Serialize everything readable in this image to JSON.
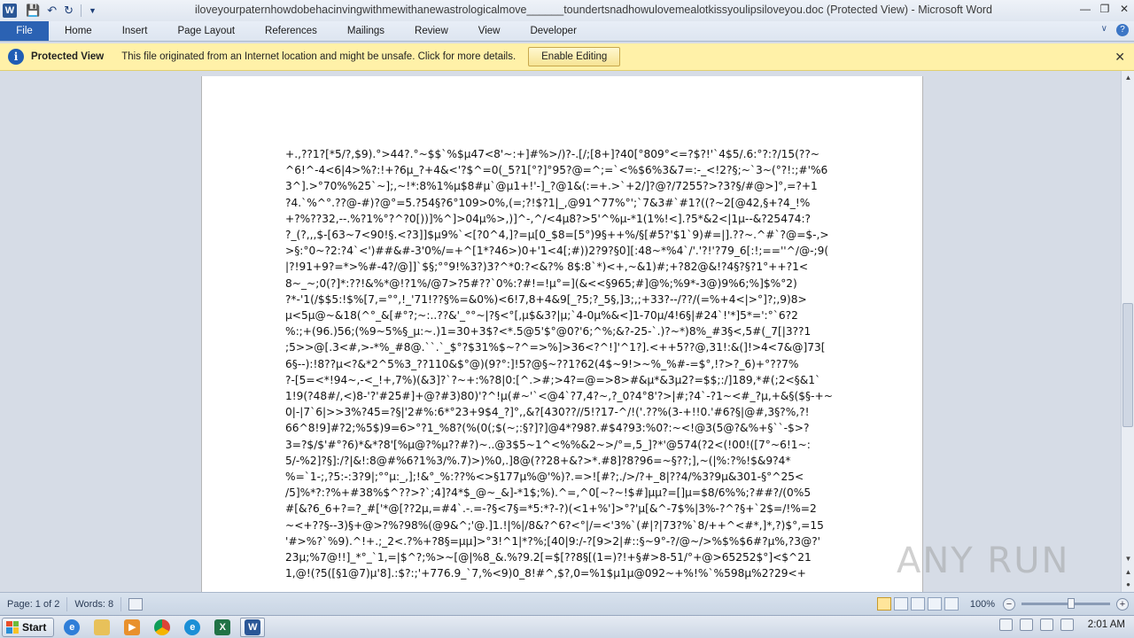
{
  "app": {
    "window_title": "iloveyourpaternhowdobehacinvingwithmewithanewastrologicalmove______toundertsnadhowulovemealotkissyoulipsiloveyou.doc (Protected View) - Microsoft Word",
    "icon_letter": "W"
  },
  "ribbon": {
    "tabs": [
      "File",
      "Home",
      "Insert",
      "Page Layout",
      "References",
      "Mailings",
      "Review",
      "View",
      "Developer"
    ]
  },
  "protected_view": {
    "title": "Protected View",
    "message": "This file originated from an Internet location and might be unsafe. Click for more details.",
    "button": "Enable Editing"
  },
  "document": {
    "lines": [
      "+.,??1?[*5/?,$9).°>44?.°~$$`%$µ47<8'~:+]#%>/)?-.[/;[8+]?40[°809°<=?$?!'`4$5/.6:°?:?/15(??~",
      "^6!^-4<6|4>%?:!+?6µ_?+4&<'?$^=0(_5?1[°?]°95?@=^;=`<%$6%3&7=:-_<!2?§;~`3~(°?!:;#'%6",
      "3^].>°70%%25`~];,~!*:8%1%µ$8#µ`@µ1+!'-]_?@1&(:=+.>`+2/]?@?/7255?>?3?§/#@>]°,=?+1",
      "?4.`%^°.??@-#)?@°=5.?54§?6°109>0%,(=;?!$?1|_,@91^77%°';`7&3#`#1?((?~2[@42,§+?4_!%",
      "+?%??32,--.%?1%°?^?0[))]%^]>04µ%>,)]^-,^/<4µ8?>5'^%µ-*1(1%!<].?5*&2<|1µ--&?25474:?",
      "?_(?,,,$-[63~7<90!§.<?3]]$µ9%`<[?0^4,]?=µ[0_$8=[5°)9§++%/§[#5?'$1`9)#=|].??~.^#`?@=$-,>",
      ">§:°0~?2:?4`<')##&#-3'0%/=+^[1*?46>)0+'1<4[;#))2?9?§0][:48~*%4`/'.'?!'?79_6[:!;==''^/@-;9(",
      "|?!91+9?=*>%#-4?/@]]`$§;°°9!%3?)3?^*0:?<&?% 8$:8`*)<+,~&1)#;+?82@&!?4§?§?1°++?1<",
      "8~_~;0(?]*:??!&%*@!?1%/@7>?5#??`0%:?#!=!µ°=](&<<§965;#]@%;%9*-3@)9%6;%]$%°2)",
      "?*-'1(/$$5:!$%[7,=°°,!_'71!??§%=&0%)<6!7,8+4&9[_?5;?_5§,]3;,;+33?--/??/(=%+4<|>°]?;,9)8>",
      "µ<5µ@~&18(^°_&[#°?;~:..??&'_°°~|?§<°[,µ$&3?|µ;`4-0µ%&<]1-70µ/4!6§|#24`!'*]5*=':°`6?2",
      "%:;+(96.)56;(%9~5%§_µ:~.)1=30+3$?<*.5@5'$°@0?'6;^%;&?-25-`.)?~*)8%_#3§<,5#(_7[|3??1",
      ";5>>@[.3<#,>-*%_#8@.``.`_$°?$31%$~?^=>%]>36<?^!]'^1?].<++5??@,31!:&(]!>4<7&@]73[",
      "6§--):!8??µ<?&*2^5%3_??110&$°@)(9?°:]!5?@§~??1?62(4$~9!>~%_%#-=$°,!?>?_6)+°??7%",
      "?-[5=<*!94~,-<_!+,7%)(&3]?`?~+:%?8|0:[^.>#;>4?=@=>8>#&µ*&3µ2?=$$;:/]189,*#(;2<§&1`",
      "1!9(?48#/,<)8-'?'#25#]+@?#3)80)'?^!µ(#~'`<@4`?7,4?~,?_0?4°8'?>|#;?4`-?1~<#_?µ,+&§($§-+~",
      "0|-|7`6|>>3%?45=?§|'2#%:6*°23+9$4_?]°,,&?[430??//5!?17-^/!('.??%(3-+!!0.'#6?§|@#,3§?%,?!",
      "66^8!9]#?2;%5$)9=6>°?1_%8?(%(0(;$(~;:§?]?]@4*?98?.#$4?93:%0?:~<!@3(5@?&%+§``-$>?",
      "3=?$/$'#°?6)*&*?8'[%µ@?%µ??#?)~..@3$5~1^<%%&2~>/°=,5_]?*'@574(?2<(!00!([7°~6!1~:",
      "5/-%2]?§]:/?|&!:8@#%6?1%3/%.7)>)%0,.]8@(??28+&?>*.#8]?8?96=~§??;],~(|%:?%!$&9?4*",
      "%=`1-;,?5:-:3?9|;°°µ:_,];!&°_%:??%<>§177µ%@'%)?.=>![#?;./>/?+_8|??4/%3?9µ&301-§°^25<",
      "/5]%*?:?%+#38%$^??>?`;4]?4*$_@~_&]-*1$;%).^=,^0[~?~!$#]µµ?=[]µ=$8/6%%;?##?/(0%5",
      "#[&?6_6+?=?_#['*@[??2µ,=#4`.-.=-?§<7§=*5:*?-?)(<1+%']>°?'µ[&^-7$%|3%-?^?§+`2$=/!%=2",
      "~<+??§--3)§+@>?%?98%(@9&^;'@.]1.!|%|/8&?^6?<°|/=<'3%`(#|?|73?%`8/++^<#*,]*,?)$°,=15",
      "'#>%?`%9).^!+.;_2<.?%+?8§=µµ]>°3!^1|*?%;[40|9:/-?[9>2|#::§~9°-?/@~/>%$%$6#?µ%,?3@?'",
      "23µ;%7@!!]_*°_`1,=|$^?;%>~[@|%8_&.%?9.2[=$[??8§[(1=)?!+§#>8-51/°+@>65252$°]<$^21",
      "1,@!(?5([§1@7)µ'8].:$?:;'+776.9_`7,%<9)0_8!#^,$?,0=%1$µ1µ@092~+%!%`%598µ%2?29<+"
    ]
  },
  "status_bar": {
    "page": "Page: 1 of 2",
    "words": "Words: 8",
    "zoom": "100%"
  },
  "taskbar": {
    "start_label": "Start",
    "clock": "2:01 AM"
  },
  "watermark": {
    "text": "ANY RUN"
  }
}
